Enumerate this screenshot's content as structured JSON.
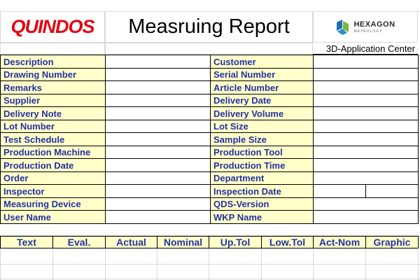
{
  "header": {
    "logo_left": "QUINDOS",
    "title": "Measruing Report",
    "logo_right_name": "HEXAGON",
    "logo_right_sub": "METROLOGY",
    "subtitle": "3D-Application Center"
  },
  "fields_left": [
    "Description",
    "Drawing Number",
    "Remarks",
    "Supplier",
    "Delivery Note",
    "Lot Number",
    "Test Schedule",
    "Production Machine",
    "Production Date",
    "Order",
    "Inspector",
    "Measuring Device",
    "User Name"
  ],
  "fields_right": [
    "Customer",
    "Serial Number",
    "Article Number",
    "Delivery Date",
    "Delivery Volume",
    "Lot Size",
    "Sample Size",
    "Production Tool",
    "Production Time",
    "Department",
    "Inspection Date",
    "QDS-Version",
    "WKP Name"
  ],
  "columns": [
    "Text",
    "Eval.",
    "Actual",
    "Nominal",
    "Up.Tol",
    "Low.Tol",
    "Act-Nom",
    "Graphic"
  ],
  "colors": {
    "label_bg": "#ffffc9",
    "label_text": "#2431a4",
    "logo_red": "#e30613",
    "hexagon_blue": "#1f6fb2",
    "hexagon_green": "#7ab648"
  }
}
